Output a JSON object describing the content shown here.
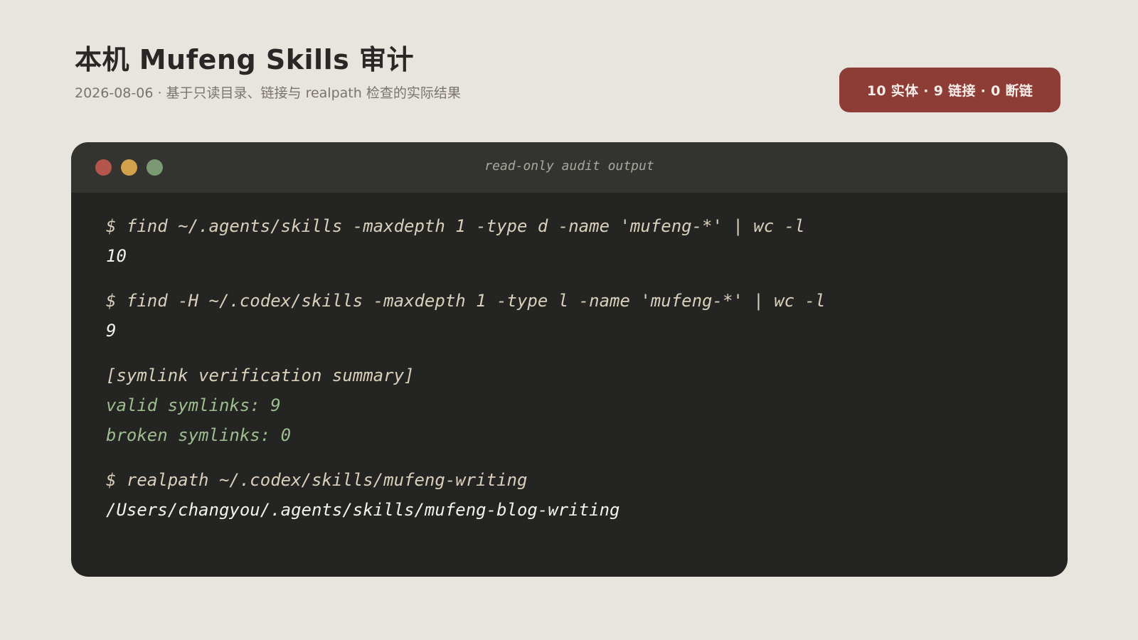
{
  "header": {
    "title": "本机 Mufeng Skills 审计",
    "subtitle": "2026-08-06 · 基于只读目录、链接与 realpath 检查的实际结果"
  },
  "badge": {
    "text": "10 实体 · 9 链接 · 0 断链"
  },
  "terminal": {
    "title": "read-only audit output",
    "lines": [
      "$ find ~/.agents/skills -maxdepth 1 -type d -name 'mufeng-*' | wc -l",
      "10",
      "$ find -H ~/.codex/skills -maxdepth 1 -type l -name 'mufeng-*' | wc -l",
      "9",
      "[symlink verification summary]",
      "valid symlinks: 9",
      "broken symlinks: 0",
      "$ realpath ~/.codex/skills/mufeng-writing",
      "/Users/changyou/.agents/skills/mufeng-blog-writing"
    ]
  },
  "colors": {
    "background": "#e8e4de",
    "badge": "#8d3c36",
    "terminal_bg": "#242422",
    "titlebar_bg": "#333330",
    "dot_red": "#b5564c",
    "dot_yellow": "#d1a24b",
    "dot_green": "#7b9a74",
    "command_text": "#d9cfbb",
    "result_text": "#f4f2ee",
    "success_text": "#9cbd8e"
  }
}
